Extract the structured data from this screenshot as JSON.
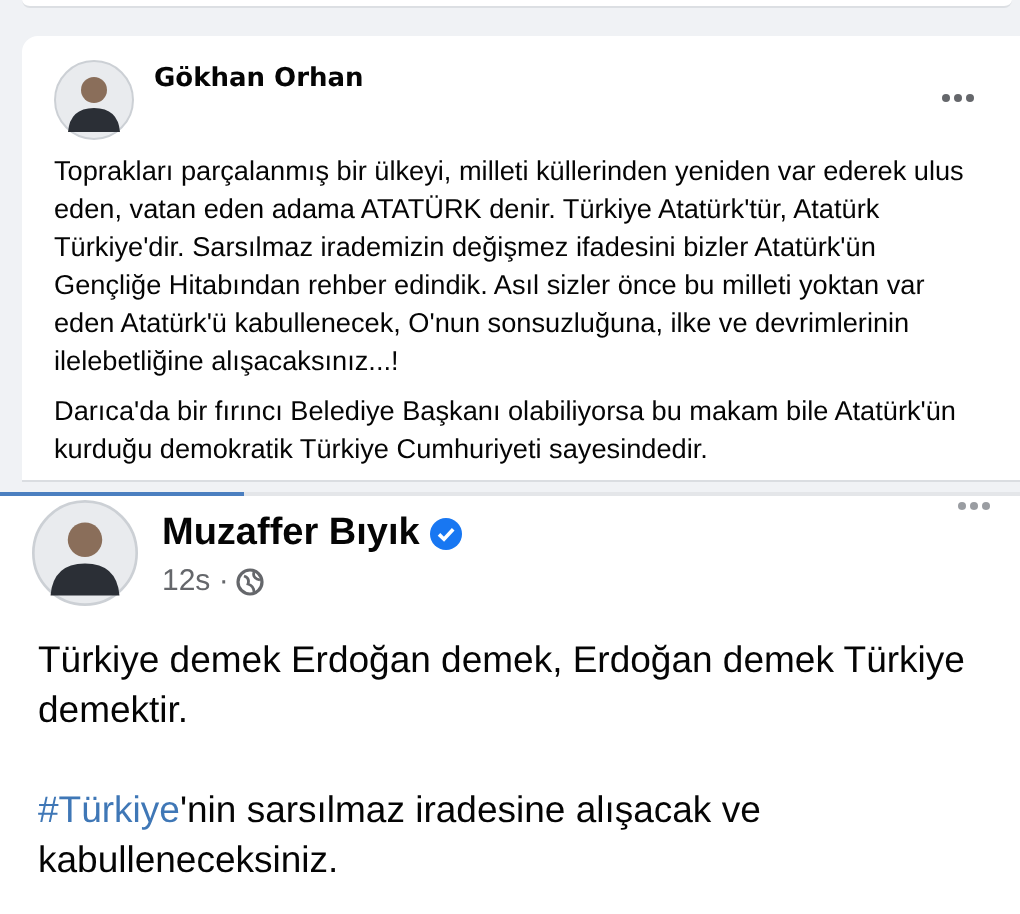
{
  "post": {
    "author": "Gökhan Orhan",
    "paragraphs": [
      "Toprakları parçalanmış bir ülkeyi, milleti küllerinden yeniden var ederek ulus eden, vatan eden adama ATATÜRK denir. Türkiye Atatürk'tür, Atatürk Türkiye'dir. Sarsılmaz irademizin değişmez ifadesini bizler Atatürk'ün Gençliğe Hitabından rehber edindik. Asıl sizler önce bu milleti yoktan var eden Atatürk'ü kabullenecek, O'nun sonsuzluğuna, ilke ve devrimlerinin ilelebetliğine alışacaksınız...!",
      "Darıca'da bir fırıncı Belediye Başkanı olabiliyorsa bu  makam bile Atatürk'ün kurduğu demokratik Türkiye Cumhuriyeti sayesindedir."
    ]
  },
  "shared_screenshot": {
    "author": "Muzaffer Bıyık",
    "verified": true,
    "time": "12s ·",
    "text": "Türkiye demek Erdoğan demek, Erdoğan demek Türkiye demektir.",
    "hashtag": "#Türkiye",
    "hashtag_rest": "'nin sarsılmaz iradesine alışacak ve kabulleneceksiniz."
  }
}
